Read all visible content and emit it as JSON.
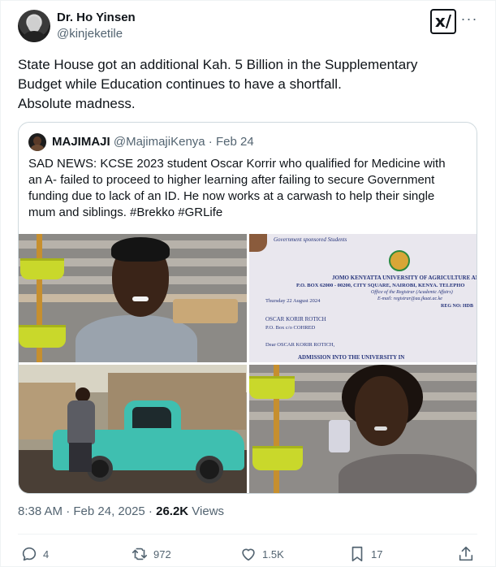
{
  "tweet": {
    "author_name": "Dr. Ho Yinsen",
    "author_handle": "@kinjeketile",
    "text_lines": [
      "State House got an additional Kah. 5 Billion in the Supplementary",
      "Budget while Education continues to have a shortfall.",
      "Absolute madness."
    ],
    "timestamp": "8:38 AM · Feb 24, 2025 · ",
    "views_count": "26.2K",
    "views_label": " Views"
  },
  "quote": {
    "name": "MAJIMAJI",
    "handle": "@MajimajiKenya",
    "date": "· Feb 24",
    "text_lines": [
      "SAD NEWS: KCSE 2023 student Oscar Korrir who qualified for Medicine with",
      "an A- failed to proceed to higher learning after failing to secure Government",
      "funding due to lack of an ID. He now works at a carwash to help their single",
      "mum and siblings. #Brekko #GRLife"
    ],
    "letter": {
      "header": "Government sponsored Students",
      "university": "JOMO KENYATTA UNIVERSITY OF AGRICULTURE AND TE",
      "address": "P.O. BOX 62000 - 00200, CITY SQUARE, NAIROBI, KENYA. TELEPHO",
      "office": "Office of the Registrar (Academic Affairs)",
      "email": "E-mail: registrar@aa.jkuat.ac.ke",
      "date": "Thursday 22 August 2024",
      "ref": "REG NO: HDB",
      "recipient": "OSCAR KORIR ROTICH",
      "box": "P.O. Box c/o COHRED",
      "salutation": "Dear OSCAR KORIR ROTICH,",
      "subject": "ADMISSION INTO THE UNIVERSITY IN"
    }
  },
  "actions": {
    "replies": "4",
    "retweets": "972",
    "likes": "1.5K",
    "bookmarks": "17"
  },
  "icons": {
    "more": "more-icon",
    "xai": "grok-icon",
    "reply": "reply-icon",
    "retweet": "retweet-icon",
    "like": "heart-icon",
    "bookmark": "bookmark-icon",
    "share": "share-icon"
  },
  "colors": {
    "text": "#0f1419",
    "muted": "#536471",
    "border": "#cfd9de"
  }
}
